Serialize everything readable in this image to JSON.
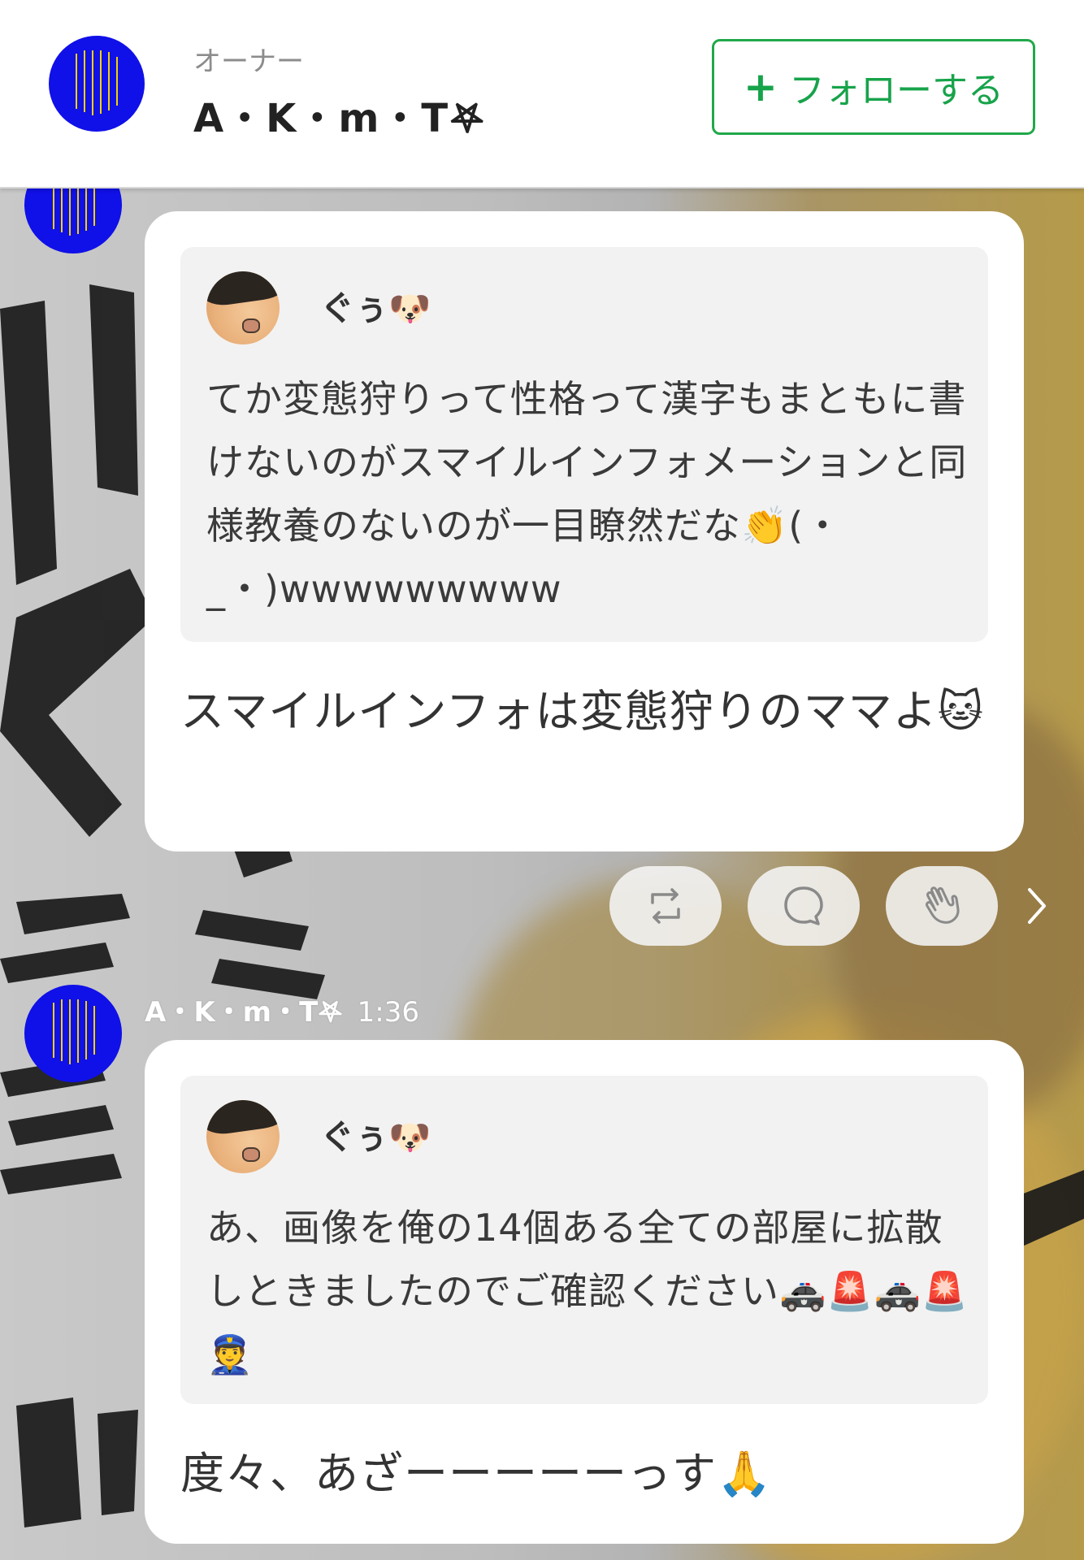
{
  "header": {
    "owner_role": "オーナー",
    "owner_name": "A・K・m・T𖤐",
    "follow_button": "フォローする",
    "follow_icon": "+"
  },
  "messages": [
    {
      "quote": {
        "author": "ぐぅ🐶",
        "text": "てか変態狩りって性格って漢字もまともに書けないのがスマイルインフォメーションと同様教養のないのが一目瞭然だな👏(・_・)wwwwwwwww"
      },
      "body": "スマイルインフォは変態狩りのママよ🐱"
    },
    {
      "sender": "A・K・m・T𖤐",
      "time": "1:36",
      "quote": {
        "author": "ぐぅ🐶",
        "text": "あ、画像を俺の14個ある全ての部屋に拡散しときましたのでご確認ください🚓🚨🚓🚨👮"
      },
      "body": "度々、あざーーーーーっす🙏"
    }
  ],
  "reactions": {
    "icons": [
      "repost-icon",
      "comment-icon",
      "clap-icon",
      "chevron-right-icon"
    ]
  },
  "colors": {
    "accent_green": "#21a84a",
    "avatar_blue": "#1010e8",
    "bubble_bg": "#ffffff",
    "quote_bg": "#f2f2f2"
  }
}
